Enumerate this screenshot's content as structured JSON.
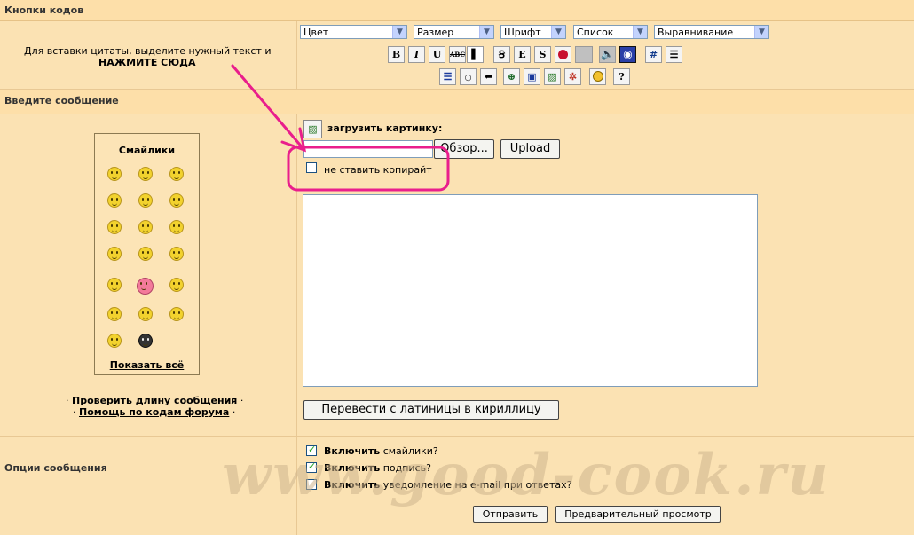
{
  "headers": {
    "code_buttons": "Кнопки кодов",
    "enter_message": "Введите сообщение",
    "message_options": "Опции сообщения"
  },
  "quote_hint": {
    "text": "Для вставки цитаты, выделите нужный текст и",
    "link": "НАЖМИТЕ СЮДА"
  },
  "toolbar": {
    "selects": [
      "Цвет",
      "Размер",
      "Шрифт",
      "Список",
      "Выравнивание"
    ],
    "row1": [
      "B",
      "I",
      "U",
      "ABC",
      "Ѩ",
      "Ꞩ",
      "E",
      "S"
    ],
    "hash_label": "#"
  },
  "smileys": {
    "title": "Смайлики",
    "show_all": "Показать всё"
  },
  "left_links": {
    "check_length": "Проверить длину сообщения",
    "help_codes": "Помощь по кодам форума",
    "bullet": "·"
  },
  "upload": {
    "label": "загрузить картинку:",
    "browse_button": "Обзор...",
    "upload_button": "Upload",
    "no_copyright": "не ставить копирайт"
  },
  "translit_button": "Перевести с латиницы в кириллицу",
  "options": [
    {
      "bold": "Включить",
      "rest": "смайлики?",
      "checked": true
    },
    {
      "bold": "Включить",
      "rest": "подпись?",
      "checked": true
    },
    {
      "bold": "Включить",
      "rest": "уведомление на e-mail при ответах?",
      "checked": false
    }
  ],
  "buttons": {
    "submit": "Отправить",
    "preview": "Предварительный просмотр"
  },
  "watermark": "www.good-cook.ru",
  "colors": {
    "annotation": "#e91e8c",
    "background": "#fbe2b3"
  }
}
